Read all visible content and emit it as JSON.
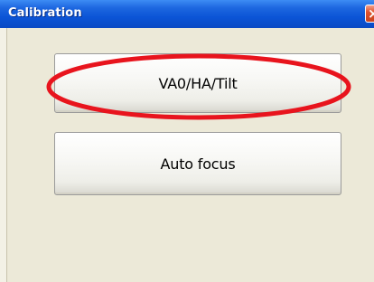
{
  "window": {
    "title": "Calibration",
    "close_icon": "close-icon"
  },
  "buttons": {
    "vao_label": "VA0/HA/Tilt",
    "autofocus_label": "Auto focus"
  },
  "annotation": {
    "shape": "ellipse",
    "color": "#e8141d"
  }
}
